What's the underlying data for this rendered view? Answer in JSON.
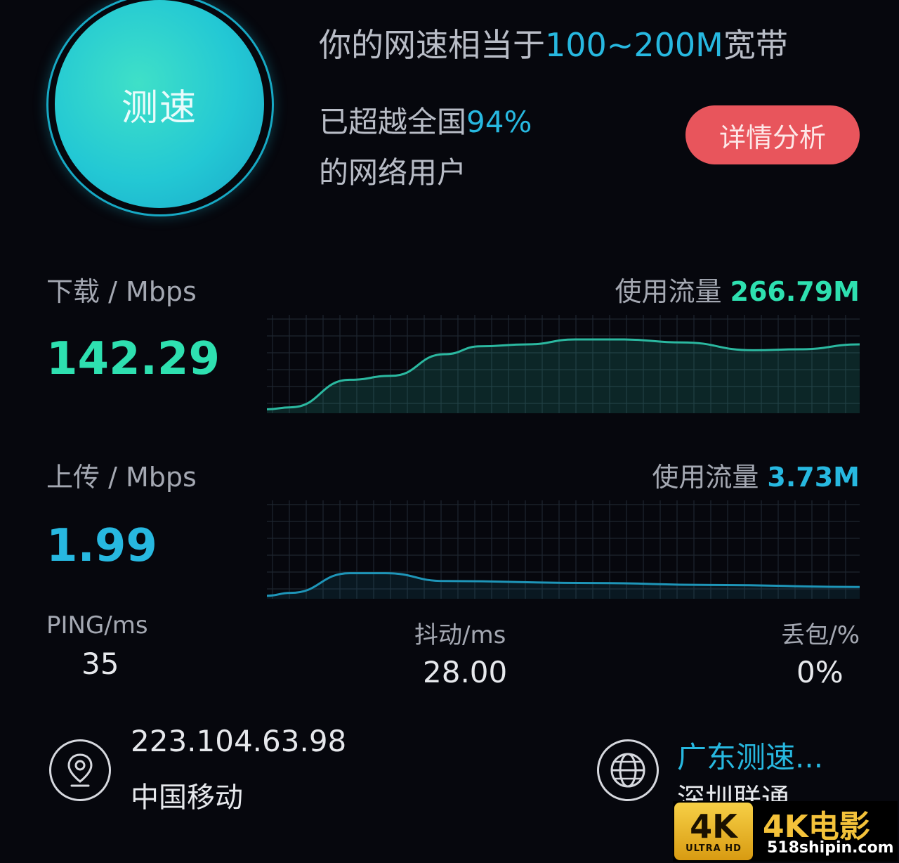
{
  "test": {
    "button_label": "测速"
  },
  "summary": {
    "speed_prefix": "你的网速相当于",
    "speed_range": "100~200M",
    "speed_suffix": "宽带",
    "rank_prefix": "已超越全国",
    "rank_percent": "94%",
    "rank_line2": "的网络用户",
    "details_button": "详情分析"
  },
  "download": {
    "label": "下载 / Mbps",
    "value": "142.29",
    "usage_label": "使用流量",
    "usage_value": "266.79M",
    "color": "#2ee0b0",
    "line_color": "#2bb8a0"
  },
  "upload": {
    "label": "上传 / Mbps",
    "value": "1.99",
    "usage_label": "使用流量",
    "usage_value": "3.73M",
    "color": "#27b8e0",
    "line_color": "#1e95b8"
  },
  "stats": {
    "ping_label": "PING/ms",
    "ping_value": "35",
    "jitter_label": "抖动/ms",
    "jitter_value": "28.00",
    "loss_label": "丢包/%",
    "loss_value": "0%"
  },
  "client": {
    "ip": "223.104.63.98",
    "isp": "中国移动",
    "icon": "location-pin-icon"
  },
  "server": {
    "name": "广东测速...",
    "isp": "深圳联通",
    "icon": "globe-icon",
    "name_color": "#27b8e0"
  },
  "watermark": {
    "badge_main": "4K",
    "badge_sub": "ULTRA HD",
    "title": "4K电影",
    "url": "518shipin.com"
  }
}
